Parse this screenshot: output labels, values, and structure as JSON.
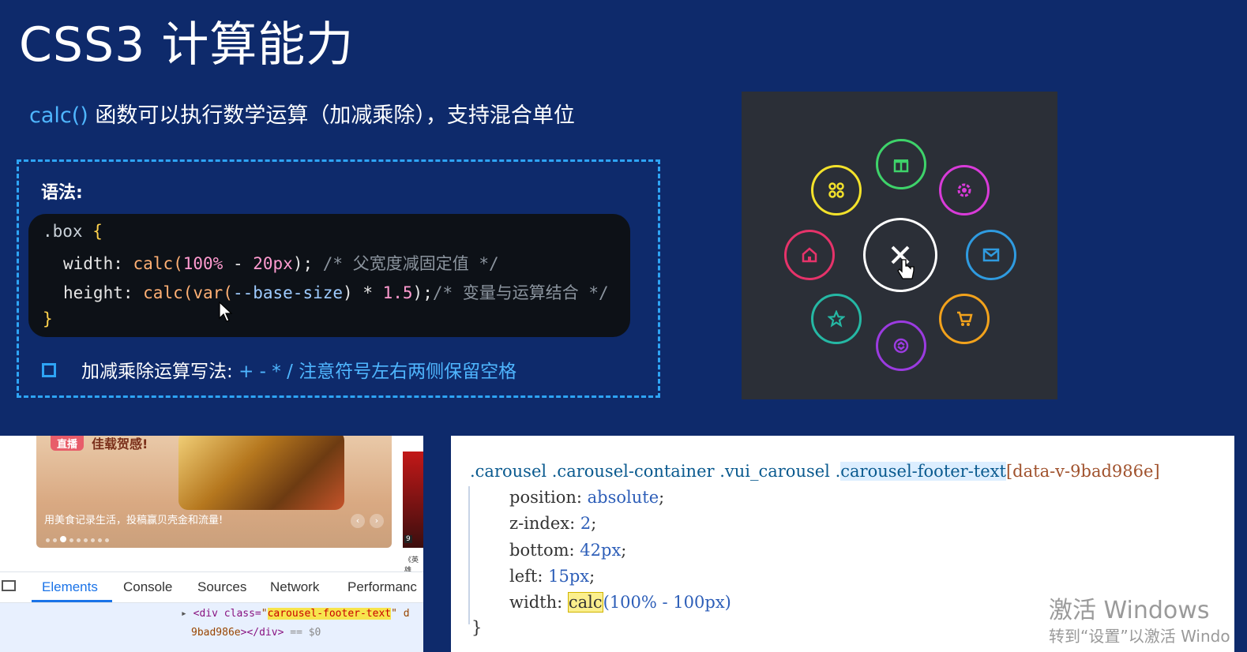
{
  "slide": {
    "title": "CSS3 计算能力",
    "subtitle_calc": "calc()",
    "subtitle_text": " 函数可以执行数学运算（加减乘除），支持混合单位",
    "syntax_label": "语法:",
    "code": {
      "line1_sel": ".box ",
      "line1_brace": "{",
      "line2_prop": "width: ",
      "line2_fn": "calc(",
      "line2_num": "100%",
      "line2_op": " - ",
      "line2_num2": "20px",
      "line2_end": ");",
      "line2_cmt": " /* 父宽度减固定值 */",
      "line3_prop": "height: ",
      "line3_fn": "calc(var(",
      "line3_var": "--base-size",
      "line3_mid": ") * ",
      "line3_num": "1.5",
      "line3_end": ");",
      "line3_cmt": "/* 变量与运算结合 */",
      "line4_brace": "}"
    },
    "note_text": "加减乘除运算写法: ",
    "note_ops": "+ - * /  注意符号左右两侧保留空格"
  },
  "demo": {
    "colors": {
      "center": "#ffffff",
      "gift": "#3ed36a",
      "settings": "#d93bd9",
      "mail": "#2f9be0",
      "cart": "#f2a21c",
      "swap": "#9b3be0",
      "star": "#25b8a4",
      "home": "#e6336a",
      "apps": "#f3e22b"
    },
    "icons": [
      "gift-icon",
      "settings-icon",
      "mail-icon",
      "cart-icon",
      "swap-icon",
      "star-icon",
      "home-icon",
      "apps-icon",
      "close-icon"
    ]
  },
  "browser": {
    "banner_tag": "直播",
    "banner_tag_text": "佳载贺感!",
    "banner_caption": "用美食记录生活，投稿赢贝壳金和流量!",
    "poster_label": "9",
    "poster_caption": "《英雄",
    "tabs": [
      "Elements",
      "Console",
      "Sources",
      "Network",
      "Performanc"
    ],
    "dom_line1_tag": "<div class=",
    "dom_line1_q": "\"",
    "dom_line1_class": "carousel-footer-text",
    "dom_line1_rest": "\" d",
    "dom_line2_attr": "9bad986e",
    "dom_line2_tail": "></div>",
    "dom_line2_eq": " == $0"
  },
  "editor": {
    "selector_1": ".carousel .carousel-container .vui_carousel .",
    "selector_2": "carousel-footer-text",
    "selector_3": "[data-v-9bad986e]",
    "l1_prop": "position: ",
    "l1_val": "absolute",
    "l2_prop": "z-index: ",
    "l2_val": "2",
    "l3_prop": "bottom: ",
    "l3_val": "42px",
    "l4_prop": "left: ",
    "l4_val": "15px",
    "l5_prop": "width: ",
    "l5_fn": "calc",
    "l5_args": "(100% - 100px)",
    "close": "}"
  },
  "watermark": {
    "line1": "激活 Windows",
    "line2": "转到“设置”以激活 Windo"
  }
}
